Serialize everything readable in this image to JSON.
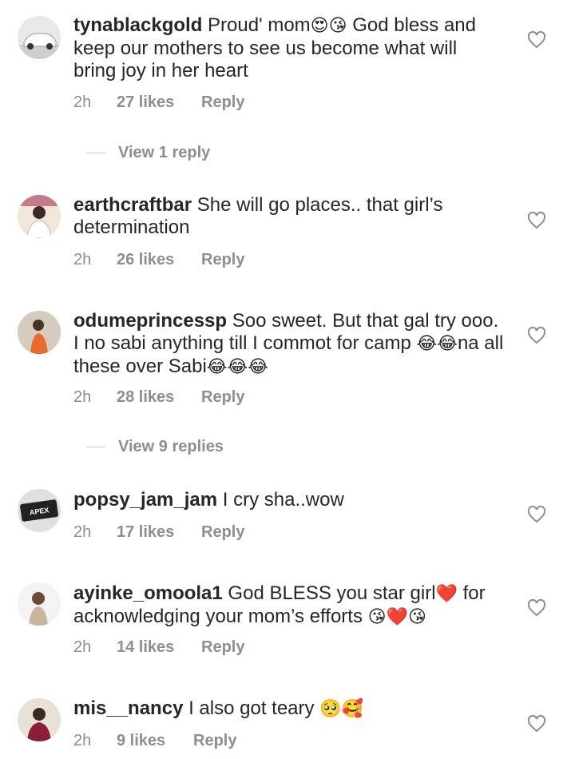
{
  "comments": [
    {
      "username": "tynablackgold",
      "text": "Proud' mom",
      "emoji1": "😍😘",
      "text2": " God bless and keep our mothers to see us become what will bring  joy in her heart",
      "time": "2h",
      "likes": "27 likes",
      "reply": "Reply",
      "avatar_icon": "car-avatar-icon"
    },
    {
      "username": "earthcraftbar",
      "text": "She will go places.. that girl’s determination",
      "time": "2h",
      "likes": "26 likes",
      "reply": "Reply",
      "avatar_icon": "person-avatar-icon"
    },
    {
      "username": "odumeprincessp",
      "text": "Soo sweet. But that gal try ooo. I no sabi anything till I commot for camp ",
      "emoji1": "😂😂",
      "text2": "na all these over Sabi",
      "emoji2": "😂😂😂",
      "time": "2h",
      "likes": "28 likes",
      "reply": "Reply",
      "avatar_icon": "person-avatar-icon"
    },
    {
      "username": "popsy_jam_jam",
      "text": "I cry sha..wow",
      "time": "2h",
      "likes": "17 likes",
      "reply": "Reply",
      "avatar_icon": "apex-logo-avatar-icon",
      "avatar_text": "APEX"
    },
    {
      "username": "ayinke_omoola1",
      "text": "God BLESS you star girl",
      "emoji1": "❤️",
      "text2": " for acknowledging your mom’s efforts ",
      "emoji2": "😘❤️😘",
      "time": "2h",
      "likes": "14 likes",
      "reply": "Reply",
      "avatar_icon": "person-avatar-icon"
    },
    {
      "username": "mis__nancy",
      "text": "I also got teary ",
      "emoji1": "🥺🥰",
      "time": "2h",
      "likes": "9 likes",
      "reply": "Reply",
      "avatar_icon": "person-avatar-icon"
    }
  ],
  "view_replies": [
    {
      "label": "View 1 reply"
    },
    {
      "label": "View 9 replies"
    }
  ],
  "colors": {
    "text": "#262626",
    "meta": "#8e8e8e",
    "heart_outline": "#8e8e8e"
  }
}
